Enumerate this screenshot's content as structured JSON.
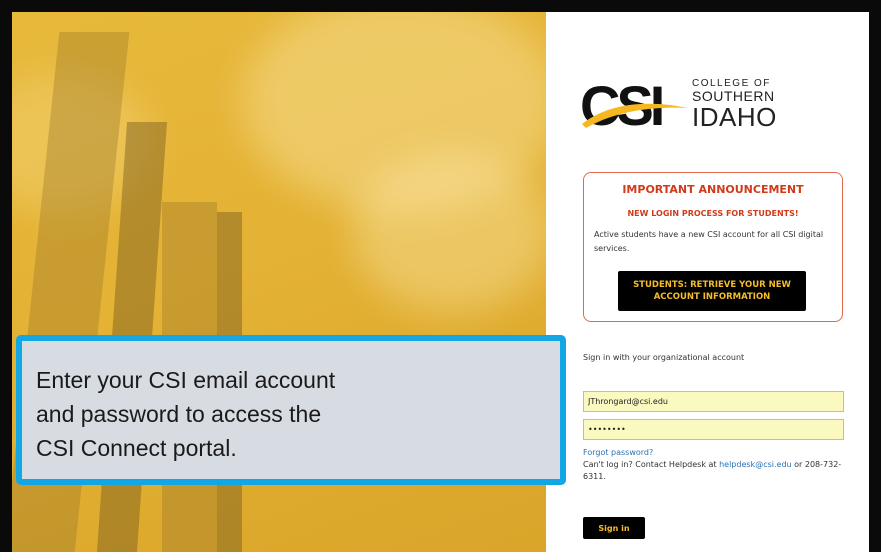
{
  "logo": {
    "letters": "CSI",
    "line1": "COLLEGE OF",
    "line2": "SOUTHERN",
    "line3": "IDAHO",
    "accent_color": "#f5b820"
  },
  "announcement": {
    "title": "IMPORTANT ANNOUNCEMENT",
    "subtitle": "NEW LOGIN PROCESS FOR STUDENTS!",
    "body": "Active students have a new CSI account for all CSI digital services.",
    "button_label": "STUDENTS: RETRIEVE YOUR NEW ACCOUNT INFORMATION",
    "border_color": "#e06a4e",
    "title_color": "#cf3b1b"
  },
  "signin": {
    "label": "Sign in with your organizational account",
    "email_value": "JThrongard@csi.edu",
    "password_value": "••••••••",
    "forgot_label": "Forgot password?",
    "help_prefix": "Can't log in? Contact Helpdesk at ",
    "help_email": "helpdesk@csi.edu",
    "help_suffix": " or 208-732-6311.",
    "button_label": "Sign in",
    "field_bg": "#fafac0"
  },
  "callout": {
    "text": "Enter your CSI email account and password to access the CSI Connect portal.",
    "border_color": "#13a6e4"
  }
}
